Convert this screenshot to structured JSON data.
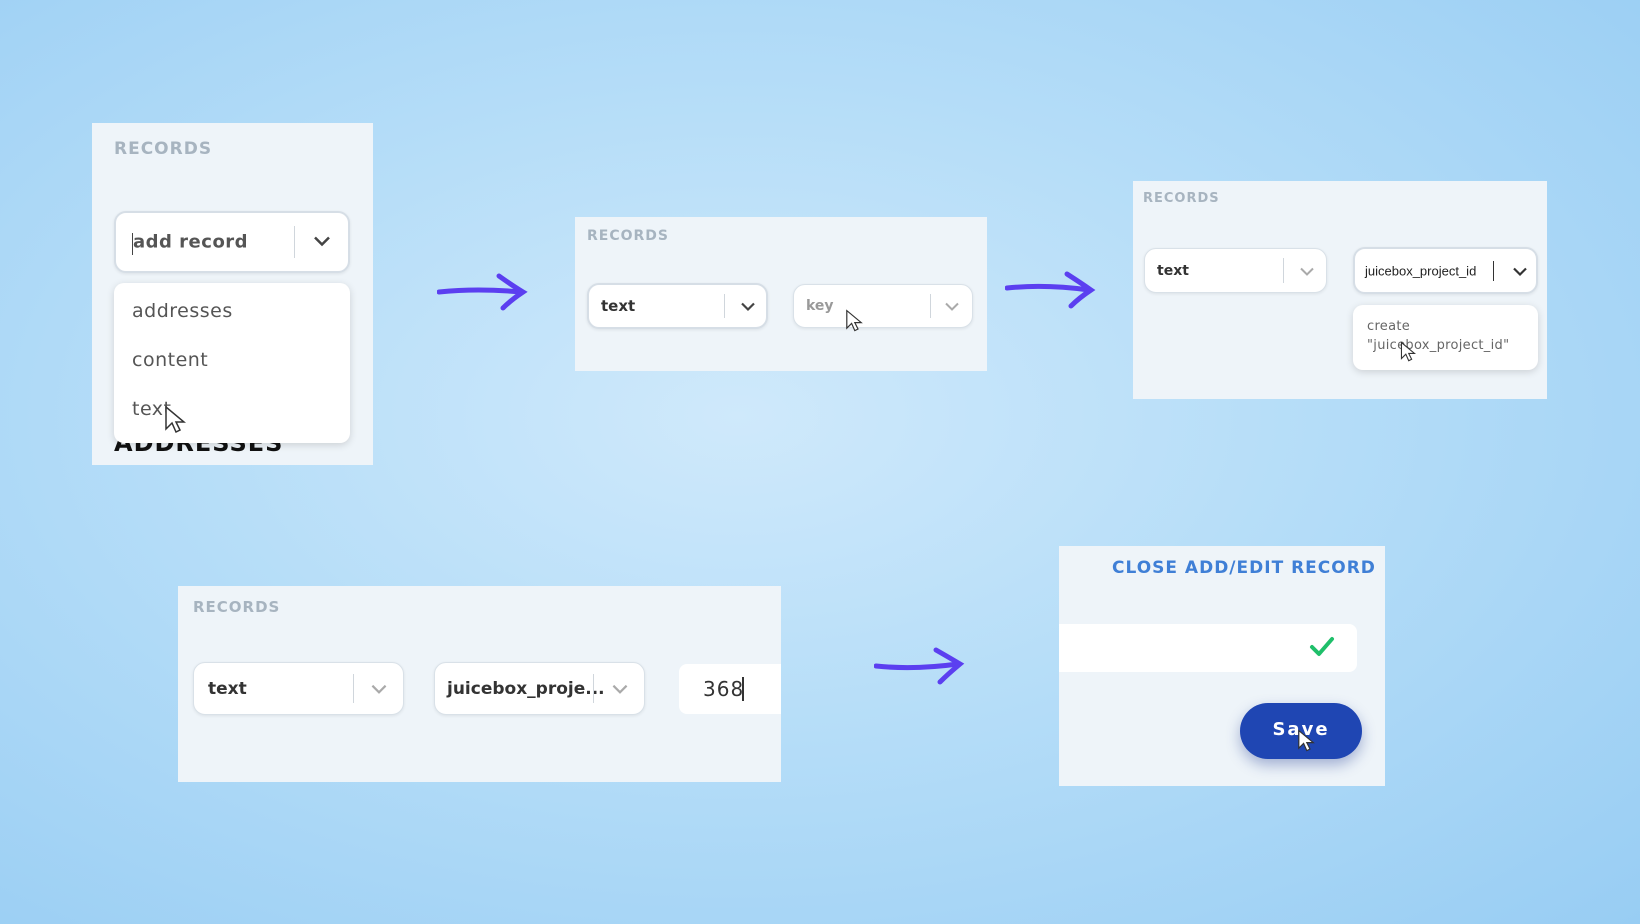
{
  "step1": {
    "section_label": "RECORDS",
    "select_value": "add record",
    "menu_items": [
      "addresses",
      "content",
      "text"
    ],
    "behind_heading": "ADDRESSES"
  },
  "step2": {
    "section_label": "RECORDS",
    "type_value": "text",
    "key_placeholder": "key"
  },
  "step3": {
    "section_label": "RECORDS",
    "type_value": "text",
    "key_value": "juicebox_project_id",
    "create_option_line1": "create",
    "create_option_line2": "\"juicebox_project_id\""
  },
  "step4": {
    "section_label": "RECORDS",
    "type_value": "text",
    "key_value": "juicebox_proje...",
    "value_input": "368"
  },
  "step5": {
    "close_link": "CLOSE ADD/EDIT RECORD",
    "save_label": "Save"
  },
  "colors": {
    "arrow": "#5b3ff0",
    "save_button": "#1f46b3",
    "check": "#1fbf6a",
    "close_link": "#3f7fd6"
  },
  "icons": [
    "chevron-down-icon",
    "arrow-right-icon",
    "cursor-icon",
    "check-icon"
  ]
}
